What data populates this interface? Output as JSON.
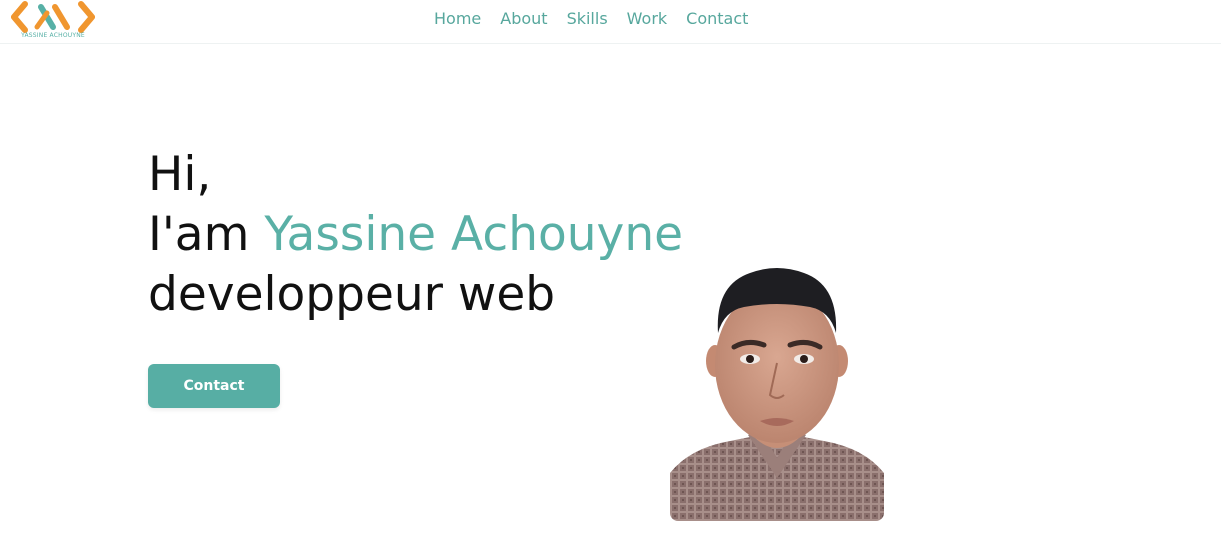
{
  "logo": {
    "text": "YASSINE ACHOUYNE",
    "accent": "#f0962f",
    "secondary": "#57b0a6"
  },
  "nav": {
    "items": [
      {
        "label": "Home"
      },
      {
        "label": "About"
      },
      {
        "label": "Skills"
      },
      {
        "label": "Work"
      },
      {
        "label": "Contact"
      }
    ]
  },
  "hero": {
    "greeting": "Hi,",
    "intro": "I'am ",
    "name": "Yassine Achouyne",
    "role": "developpeur web",
    "button_label": "Contact"
  },
  "colors": {
    "primary": "#57aea4",
    "text": "#111111"
  }
}
